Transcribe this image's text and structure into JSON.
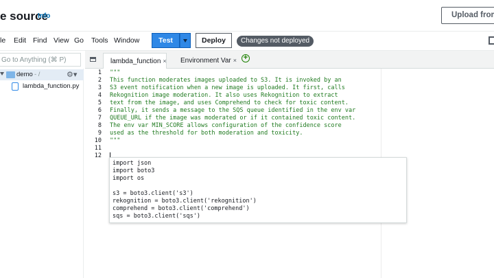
{
  "header": {
    "title": "e source",
    "info_link": "Info",
    "upload_button": "Upload from"
  },
  "menu": {
    "items": [
      "le",
      "Edit",
      "Find",
      "View",
      "Go",
      "Tools",
      "Window"
    ],
    "test_button": "Test",
    "deploy_button": "Deploy",
    "status_badge": "Changes not deployed"
  },
  "ide": {
    "search_placeholder": "Go to Anything (⌘ P)",
    "tree": {
      "folder_name": "demo",
      "folder_suffix": "- /",
      "file_name": "lambda_function.py"
    },
    "tabs": [
      {
        "label": "lambda_function",
        "close": "×"
      },
      {
        "label": "Environment Var",
        "close": "×"
      }
    ],
    "editor": {
      "line_numbers": [
        "1",
        "2",
        "3",
        "4",
        "5",
        "6",
        "7",
        "8",
        "9",
        "10",
        "11",
        "12"
      ],
      "lines": [
        "\"\"\"",
        "This function moderates images uploaded to S3. It is invoked by an",
        "S3 event notification when a new image is uploaded. It first, calls",
        "Rekognition image moderation. It also uses Rekognition to extract",
        "text from the image, and uses Comprehend to check for toxic content.",
        "Finally, it sends a message to the SQS queue identified in the env var",
        "QUEUE_URL if the image was moderated or if it contained toxic content.",
        "The env var MIN_SCORE allows configuration of the confidence score",
        "used as the threshold for both moderation and toxicity.",
        "\"\"\"",
        "",
        ""
      ]
    },
    "suggestion": {
      "lines": [
        "import json",
        "import boto3",
        "import os",
        "",
        "s3 = boto3.client('s3')",
        "rekognition = boto3.client('rekognition')",
        "comprehend = boto3.client('comprehend')",
        "sqs = boto3.client('sqs')"
      ]
    }
  }
}
